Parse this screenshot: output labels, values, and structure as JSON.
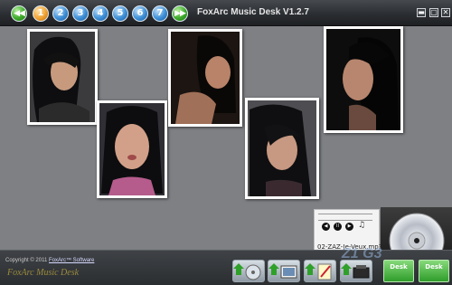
{
  "window": {
    "title": "FoxArc Music Desk V1.2.7",
    "minimize_symbol": "▬",
    "close_symbol": "✕"
  },
  "navigation": {
    "prev_symbol": "◀◀",
    "next_symbol": "▶▶",
    "desks": [
      "1",
      "2",
      "3",
      "4",
      "5",
      "6",
      "7"
    ],
    "active_desk": "1"
  },
  "photos": [
    {
      "name": "portrait-looking-right"
    },
    {
      "name": "portrait-kiss"
    },
    {
      "name": "portrait-profile-dark"
    },
    {
      "name": "portrait-hair-over-face"
    },
    {
      "name": "portrait-profile-right"
    }
  ],
  "player": {
    "track": "02-ZAZ-Je-Veux.mp3",
    "prev_symbol": "◀",
    "pause_symbol": "II",
    "next_symbol": "▶"
  },
  "footer": {
    "copyright_prefix": "Copyright © 2011",
    "company_link": "FoxArc™ Software",
    "brand": "FoxArc Music Desk"
  },
  "toolbar": {
    "tools": [
      "add-music-tool",
      "add-photo-tool",
      "notes-tool",
      "settings-tool"
    ],
    "desk_buttons": [
      "Desk",
      "Desk"
    ]
  },
  "watermark": "Z1 G3"
}
